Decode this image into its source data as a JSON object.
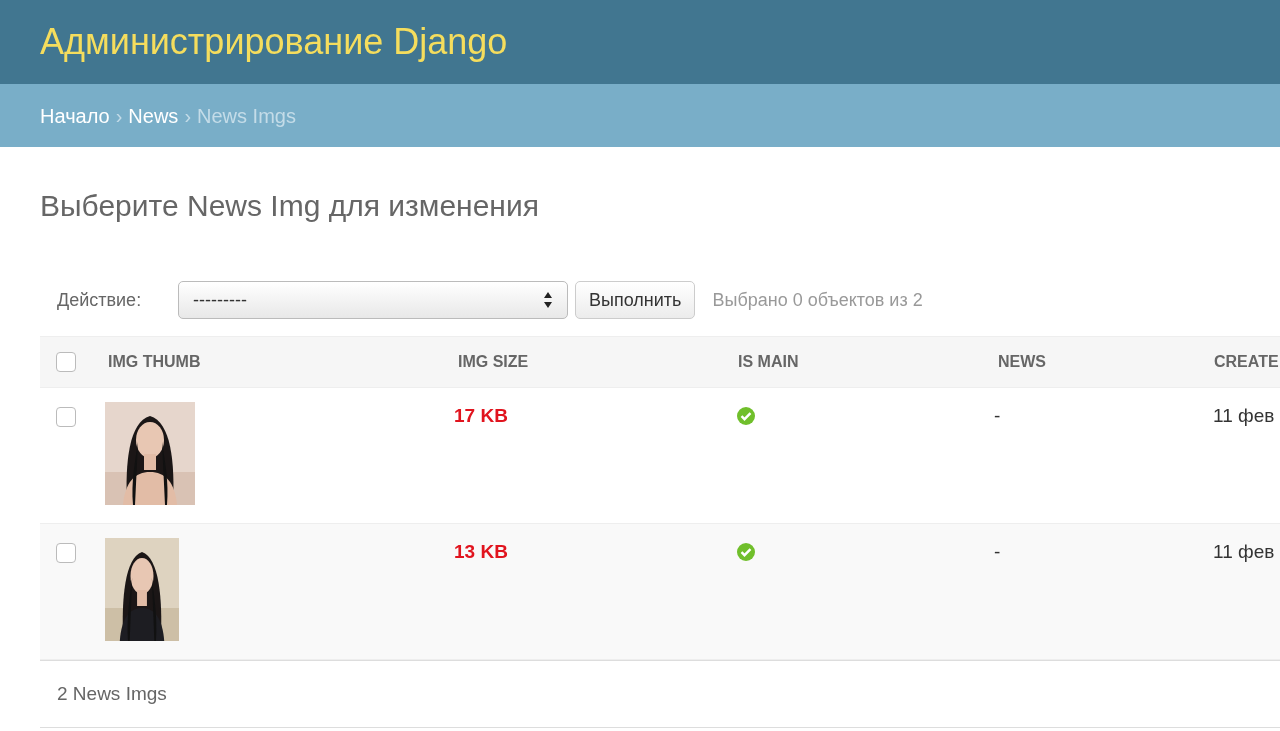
{
  "header": {
    "title": "Администрирование Django"
  },
  "breadcrumbs": [
    {
      "label": "Начало",
      "current": false
    },
    {
      "label": "News",
      "current": false
    },
    {
      "label": "News Imgs",
      "current": true
    }
  ],
  "breadcrumb_separator": "›",
  "page_title": "Выберите News Img для изменения",
  "actions": {
    "label": "Действие:",
    "select_value": "---------",
    "button": "Выполнить",
    "selection_count": "Выбрано 0 объектов из 2"
  },
  "table": {
    "select_all_checked": false,
    "columns": [
      "IMG THUMB",
      "IMG SIZE",
      "IS MAIN",
      "NEWS",
      "CREATE"
    ],
    "rows": [
      {
        "checked": false,
        "img_size": "17 KB",
        "is_main": true,
        "news": "-",
        "created": "11 фев"
      },
      {
        "checked": false,
        "img_size": "13 KB",
        "is_main": true,
        "news": "-",
        "created": "11 фев"
      }
    ]
  },
  "footer": {
    "count": "2 News Imgs"
  }
}
